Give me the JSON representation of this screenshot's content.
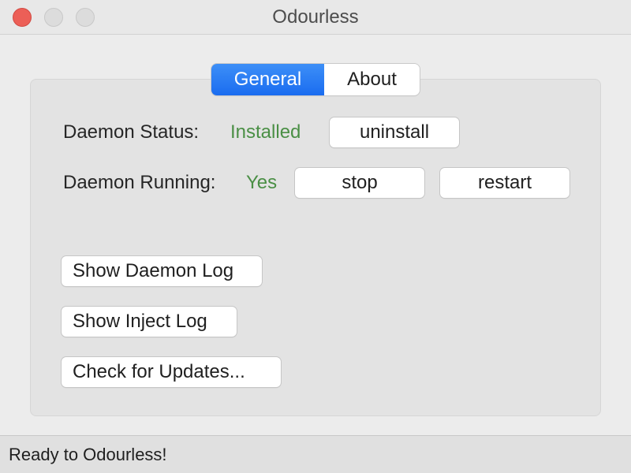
{
  "window": {
    "title": "Odourless"
  },
  "tabs": [
    {
      "label": "General",
      "selected": true
    },
    {
      "label": "About",
      "selected": false
    }
  ],
  "general": {
    "daemon_status_label": "Daemon Status:",
    "daemon_status_value": "Installed",
    "uninstall_button": "uninstall",
    "daemon_running_label": "Daemon Running:",
    "daemon_running_value": "Yes",
    "stop_button": "stop",
    "restart_button": "restart",
    "show_daemon_log_button": "Show Daemon Log",
    "show_inject_log_button": "Show Inject Log",
    "check_updates_button": "Check for Updates..."
  },
  "status_bar": {
    "text": "Ready to Odourless!"
  },
  "colors": {
    "accent": "#1a6cf0",
    "status_ok": "#4a8f45",
    "close_button": "#ec5f57"
  }
}
